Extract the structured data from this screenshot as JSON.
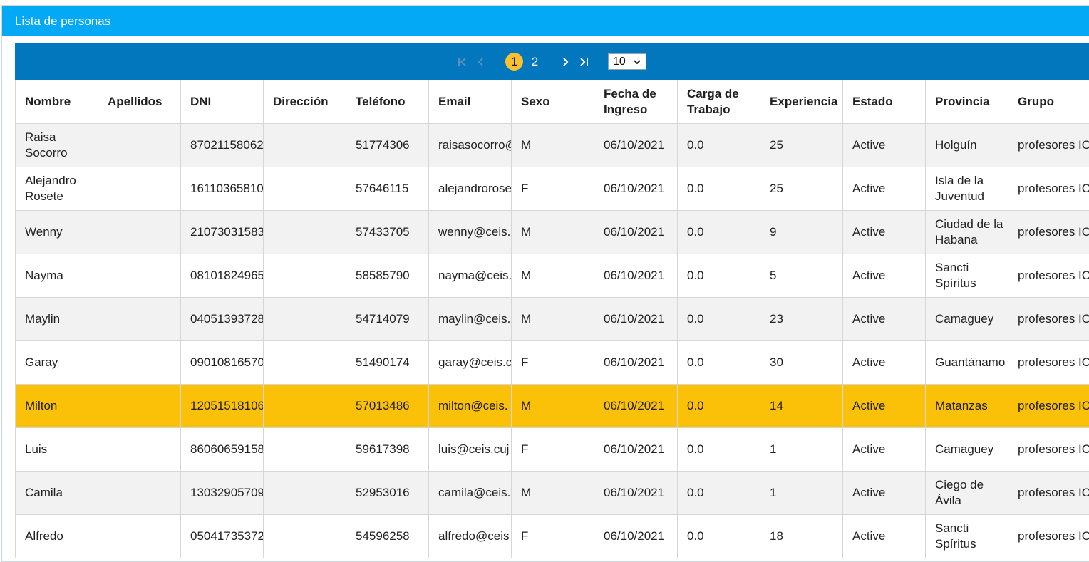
{
  "panel": {
    "title": "Lista de personas"
  },
  "pager": {
    "pages": [
      "1",
      "2"
    ],
    "current_page": "1",
    "page_size": "10"
  },
  "columns": [
    "Nombre",
    "Apellidos",
    "DNI",
    "Dirección",
    "Teléfono",
    "Email",
    "Sexo",
    "Fecha de Ingreso",
    "Carga de Trabajo",
    "Experiencia",
    "Estado",
    "Provincia",
    "Grupo"
  ],
  "rows": [
    {
      "nombre": "Raisa Socorro",
      "apellidos": "",
      "dni": "87021158062",
      "direccion": "",
      "telefono": "51774306",
      "email": "raisasocorro@",
      "sexo": "M",
      "fecha": "06/10/2021",
      "carga": "0.0",
      "experiencia": "25",
      "estado": "Active",
      "provincia": "Holguín",
      "grupo": "profesores IC"
    },
    {
      "nombre": "Alejandro Rosete",
      "apellidos": "",
      "dni": "16110365810",
      "direccion": "",
      "telefono": "57646115",
      "email": "alejandrorose",
      "sexo": "F",
      "fecha": "06/10/2021",
      "carga": "0.0",
      "experiencia": "25",
      "estado": "Active",
      "provincia": "Isla de la Juventud",
      "grupo": "profesores IC"
    },
    {
      "nombre": "Wenny",
      "apellidos": "",
      "dni": "21073031583",
      "direccion": "",
      "telefono": "57433705",
      "email": "wenny@ceis.",
      "sexo": "M",
      "fecha": "06/10/2021",
      "carga": "0.0",
      "experiencia": "9",
      "estado": "Active",
      "provincia": "Ciudad de la Habana",
      "grupo": "profesores IC"
    },
    {
      "nombre": "Nayma",
      "apellidos": "",
      "dni": "08101824965",
      "direccion": "",
      "telefono": "58585790",
      "email": "nayma@ceis.",
      "sexo": "M",
      "fecha": "06/10/2021",
      "carga": "0.0",
      "experiencia": "5",
      "estado": "Active",
      "provincia": "Sancti Spíritus",
      "grupo": "profesores IC"
    },
    {
      "nombre": "Maylin",
      "apellidos": "",
      "dni": "04051393728",
      "direccion": "",
      "telefono": "54714079",
      "email": "maylin@ceis.",
      "sexo": "M",
      "fecha": "06/10/2021",
      "carga": "0.0",
      "experiencia": "23",
      "estado": "Active",
      "provincia": "Camaguey",
      "grupo": "profesores IC"
    },
    {
      "nombre": "Garay",
      "apellidos": "",
      "dni": "09010816570",
      "direccion": "",
      "telefono": "51490174",
      "email": "garay@ceis.c",
      "sexo": "F",
      "fecha": "06/10/2021",
      "carga": "0.0",
      "experiencia": "30",
      "estado": "Active",
      "provincia": "Guantánamo",
      "grupo": "profesores IC"
    },
    {
      "nombre": "Milton",
      "apellidos": "",
      "dni": "12051518106",
      "direccion": "",
      "telefono": "57013486",
      "email": "milton@ceis.",
      "sexo": "M",
      "fecha": "06/10/2021",
      "carga": "0.0",
      "experiencia": "14",
      "estado": "Active",
      "provincia": "Matanzas",
      "grupo": "profesores IC"
    },
    {
      "nombre": "Luis",
      "apellidos": "",
      "dni": "86060659158",
      "direccion": "",
      "telefono": "59617398",
      "email": "luis@ceis.cuj",
      "sexo": "F",
      "fecha": "06/10/2021",
      "carga": "0.0",
      "experiencia": "1",
      "estado": "Active",
      "provincia": "Camaguey",
      "grupo": "profesores IC"
    },
    {
      "nombre": "Camila",
      "apellidos": "",
      "dni": "13032905709",
      "direccion": "",
      "telefono": "52953016",
      "email": "camila@ceis.",
      "sexo": "M",
      "fecha": "06/10/2021",
      "carga": "0.0",
      "experiencia": "1",
      "estado": "Active",
      "provincia": "Ciego de Ávila",
      "grupo": "profesores IC"
    },
    {
      "nombre": "Alfredo",
      "apellidos": "",
      "dni": "05041735372",
      "direccion": "",
      "telefono": "54596258",
      "email": "alfredo@ceis",
      "sexo": "F",
      "fecha": "06/10/2021",
      "carga": "0.0",
      "experiencia": "18",
      "estado": "Active",
      "provincia": "Sancti Spíritus",
      "grupo": "profesores IC"
    }
  ],
  "selected_row": "Milton",
  "colors": {
    "header": "#03a9f4",
    "pager": "#0277bd",
    "accent": "#fbc02d",
    "selected_row": "#fbc108",
    "odd_row": "#f2f2f2"
  }
}
